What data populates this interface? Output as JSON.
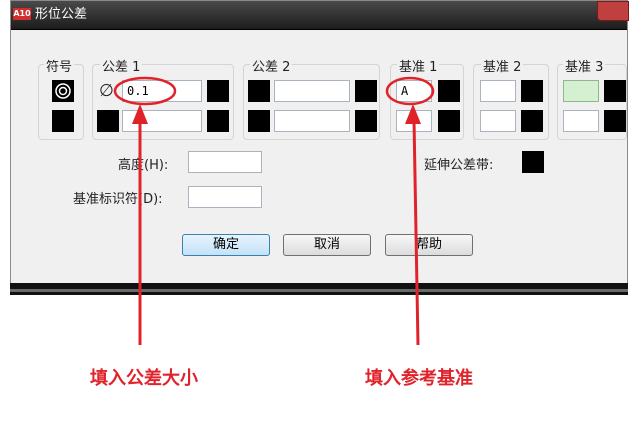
{
  "window": {
    "title": "形位公差",
    "app_icon_text": "A10"
  },
  "groups": {
    "symbol": "符号",
    "tolerance1": "公差 1",
    "tolerance2": "公差 2",
    "datum1": "基准 1",
    "datum2": "基准 2",
    "datum3": "基准 3"
  },
  "fields": {
    "tolerance1_value": "0.1",
    "diameter_symbol": "∅",
    "datum1_value": "A",
    "height_label": "高度(H):",
    "datum_identifier_label": "基准标识符(D):",
    "projected_zone_label": "延伸公差带:"
  },
  "buttons": {
    "ok": "确定",
    "cancel": "取消",
    "help": "帮助"
  },
  "annotations": {
    "tolerance_note": "填入公差大小",
    "datum_note": "填入参考基准"
  },
  "colors": {
    "annotation": "#e0232a",
    "datum3_fill": "#d5f0d0",
    "title_bar": "#1c1c1c"
  },
  "icons": {
    "symbol_button": "concentricity-icon"
  }
}
